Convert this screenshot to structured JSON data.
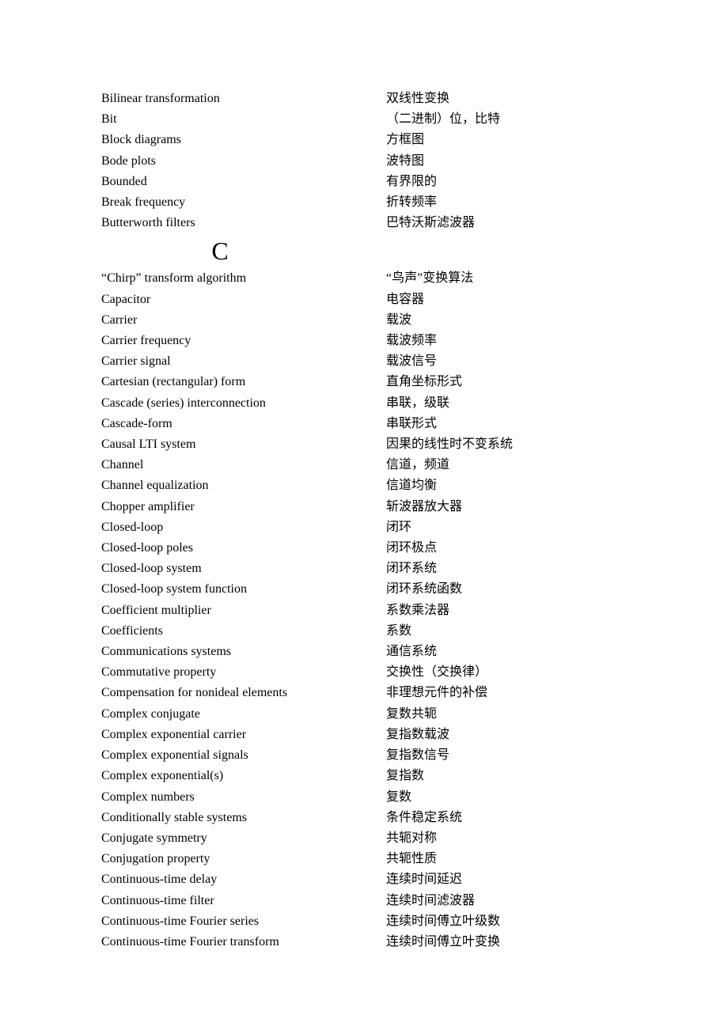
{
  "sectionB": [
    {
      "en": "Bilinear transformation",
      "zh": "双线性变换"
    },
    {
      "en": "Bit",
      "zh": "（二进制）位，比特"
    },
    {
      "en": "Block diagrams",
      "zh": "方框图"
    },
    {
      "en": "Bode plots",
      "zh": "波特图"
    },
    {
      "en": "Bounded",
      "zh": "有界限的"
    },
    {
      "en": "Break frequency",
      "zh": "折转频率"
    },
    {
      "en": "Butterworth filters",
      "zh": "巴特沃斯滤波器"
    }
  ],
  "sectionC_letter": "C",
  "sectionC": [
    {
      "en": "“Chirp” transform algorithm",
      "zh": "“鸟声”变换算法"
    },
    {
      "en": "Capacitor",
      "zh": "电容器"
    },
    {
      "en": "Carrier",
      "zh": "载波"
    },
    {
      "en": "Carrier frequency",
      "zh": "载波频率"
    },
    {
      "en": "Carrier signal",
      "zh": "载波信号"
    },
    {
      "en": "Cartesian (rectangular) form",
      "zh": "直角坐标形式"
    },
    {
      "en": "Cascade (series) interconnection",
      "zh": "串联，级联"
    },
    {
      "en": "Cascade-form",
      "zh": "串联形式"
    },
    {
      "en": "Causal LTI system",
      "zh": "因果的线性时不变系统"
    },
    {
      "en": "Channel",
      "zh": "信道，频道"
    },
    {
      "en": "Channel equalization",
      "zh": "信道均衡"
    },
    {
      "en": "Chopper amplifier",
      "zh": "斩波器放大器"
    },
    {
      "en": "Closed-loop",
      "zh": "闭环"
    },
    {
      "en": "Closed-loop poles",
      "zh": "闭环极点"
    },
    {
      "en": "Closed-loop system",
      "zh": "闭环系统"
    },
    {
      "en": "Closed-loop system function",
      "zh": "闭环系统函数"
    },
    {
      "en": "Coefficient multiplier",
      "zh": "系数乘法器"
    },
    {
      "en": "Coefficients",
      "zh": "系数"
    },
    {
      "en": "Communications systems",
      "zh": "通信系统"
    },
    {
      "en": "Commutative property",
      "zh": "交换性（交换律）"
    },
    {
      "en": "Compensation for nonideal elements",
      "zh": "非理想元件的补偿"
    },
    {
      "en": "Complex conjugate",
      "zh": "复数共轭"
    },
    {
      "en": "Complex exponential carrier",
      "zh": "复指数载波"
    },
    {
      "en": "Complex exponential signals",
      "zh": "复指数信号"
    },
    {
      "en": "Complex exponential(s)",
      "zh": "复指数"
    },
    {
      "en": "Complex numbers",
      "zh": "复数"
    },
    {
      "en": "Conditionally stable systems",
      "zh": "条件稳定系统"
    },
    {
      "en": "Conjugate symmetry",
      "zh": "共轭对称"
    },
    {
      "en": "Conjugation property",
      "zh": "共轭性质"
    },
    {
      "en": "Continuous-time delay",
      "zh": "连续时间延迟"
    },
    {
      "en": "Continuous-time filter",
      "zh": "连续时间滤波器"
    },
    {
      "en": "Continuous-time Fourier series",
      "zh": "连续时间傅立叶级数"
    },
    {
      "en": "Continuous-time Fourier transform",
      "zh": "连续时间傅立叶变换"
    }
  ]
}
